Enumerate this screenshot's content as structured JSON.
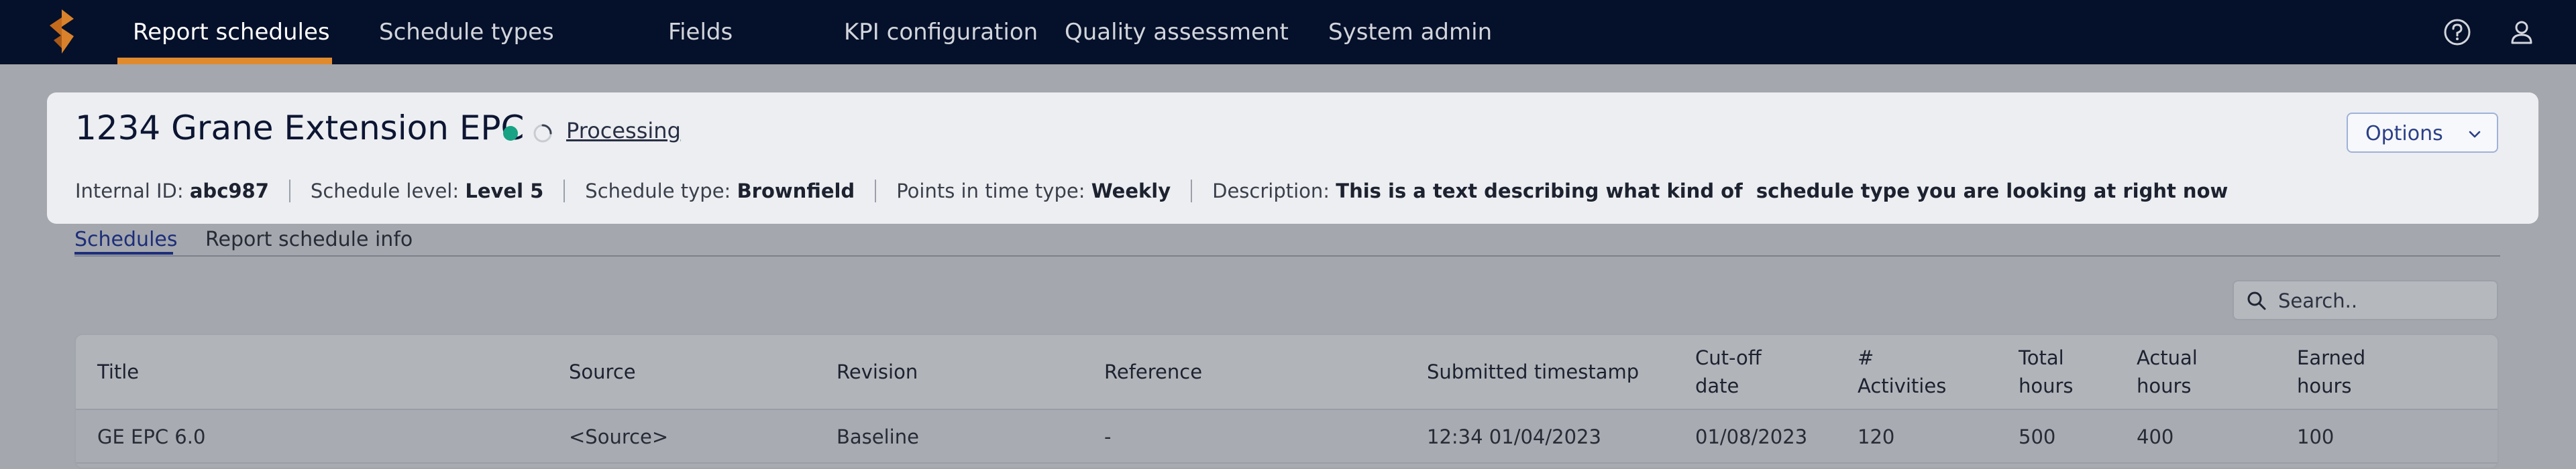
{
  "nav": {
    "items": [
      "Report schedules",
      "Schedule types",
      "Fields",
      "KPI configuration",
      "Quality assessment",
      "System admin"
    ],
    "active_index": 0,
    "icons": [
      "help-icon",
      "user-icon"
    ]
  },
  "header": {
    "title": "1234 Grane Extension EPC",
    "status_color": "#17a384",
    "processing": "Processing",
    "options_label": "Options",
    "meta": [
      {
        "label": "Internal ID:",
        "value": "abc987"
      },
      {
        "label": "Schedule level:",
        "value": "Level 5"
      },
      {
        "label": "Schedule type:",
        "value": "Brownfield"
      },
      {
        "label": "Points in time type:",
        "value": "Weekly"
      },
      {
        "label": "Description:",
        "value": "This is a text describing what kind of  schedule type you are looking at right now"
      }
    ]
  },
  "tabs": [
    {
      "label": "Schedules",
      "active": true
    },
    {
      "label": "Report schedule info",
      "active": false
    }
  ],
  "search": {
    "placeholder": "Search.."
  },
  "table": {
    "columns": [
      [
        "Title"
      ],
      [
        "Source"
      ],
      [
        "Revision"
      ],
      [
        "Reference"
      ],
      [
        "Submitted timestamp"
      ],
      [
        "Cut-off",
        "date"
      ],
      [
        "#",
        "Activities"
      ],
      [
        "Total",
        "hours"
      ],
      [
        "Actual",
        "hours"
      ],
      [
        "Earned",
        "hours"
      ]
    ],
    "rows": [
      [
        "GE EPC 6.0",
        "<Source>",
        "Baseline",
        "-",
        "12:34 01/04/2023",
        "01/08/2023",
        "120",
        "500",
        "400",
        "100"
      ]
    ]
  },
  "colors": {
    "nav_bg": "#05102a",
    "accent": "#e08a2e",
    "link": "#1d2e7a"
  }
}
